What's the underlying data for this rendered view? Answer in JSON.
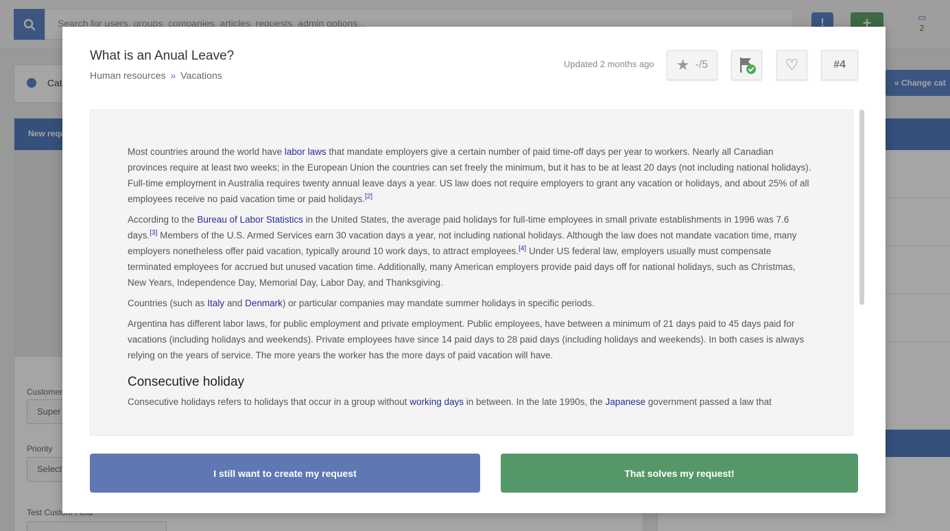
{
  "topbar": {
    "search_placeholder": "Search for users, groups, companies, articles, requests, admin options...",
    "alert_label": "!",
    "add_label": "+",
    "notification_count": "2"
  },
  "background": {
    "category_label": "Categ",
    "change_category": "« Change cat",
    "new_request_header": "New requ",
    "customer_label": "Customer",
    "customer_value": "Super A",
    "priority_label": "Priority",
    "priority_value": "Select",
    "custom_field_label": "Test Custom Field"
  },
  "modal": {
    "title": "What is an Anual Leave?",
    "breadcrumb": {
      "parent": "Human resources",
      "separator": "»",
      "child": "Vacations"
    },
    "updated": "Updated 2 months ago",
    "rating": "-/5",
    "article_number": "#4",
    "article": {
      "p1_a": "Most countries around the world have ",
      "p1_link": "labor laws",
      "p1_b": " that mandate employers give a certain number of paid time-off days per year to workers. Nearly all Canadian provinces require at least two weeks; in the European Union the countries can set freely the minimum, but it has to be at least 20 days (not including national holidays). Full-time employment in Australia requires twenty annual leave days a year. US law does not require employers to grant any vacation or holidays, and about 25% of all employees receive no paid vacation time or paid holidays.",
      "p1_ref": "[2]",
      "p2_a": "According to the ",
      "p2_link": "Bureau of Labor Statistics",
      "p2_b": " in the United States, the average paid holidays for full-time employees in small private establishments in 1996 was 7.6 days.",
      "p2_ref1": "[3]",
      "p2_c": " Members of the U.S. Armed Services earn 30 vacation days a year, not including national holidays. Although the law does not mandate vacation time, many employers nonetheless offer paid vacation, typically around 10 work days, to attract employees.",
      "p2_ref2": "[4]",
      "p2_d": " Under US federal law, employers usually must compensate terminated employees for accrued but unused vacation time. Additionally, many American employers provide paid days off for national holidays, such as Christmas, New Years, Independence Day, Memorial Day, Labor Day, and Thanksgiving.",
      "p3_a": "Countries (such as ",
      "p3_link1": "Italy",
      "p3_b": " and ",
      "p3_link2": "Denmark",
      "p3_c": ") or particular companies may mandate summer holidays in specific periods.",
      "p4": "Argentina has different labor laws, for public employment and private employment. Public employees, have between a minimum of 21 days paid to 45 days paid for vacations (including holidays and weekends). Private employees have since 14 paid days to 28 paid days (including holidays and weekends). In both cases is always relying on the years of service. The more years the worker has the more days of paid vacation will have.",
      "heading": "Consecutive holiday",
      "p5_a": "Consecutive holidays refers to holidays that occur in a group without ",
      "p5_link1": "working days",
      "p5_b": " in between. In the late 1990s, the ",
      "p5_link2": "Japanese",
      "p5_c": " government passed a law that"
    },
    "create_button": "I still want to create my request",
    "solve_button": "That solves my request!"
  }
}
